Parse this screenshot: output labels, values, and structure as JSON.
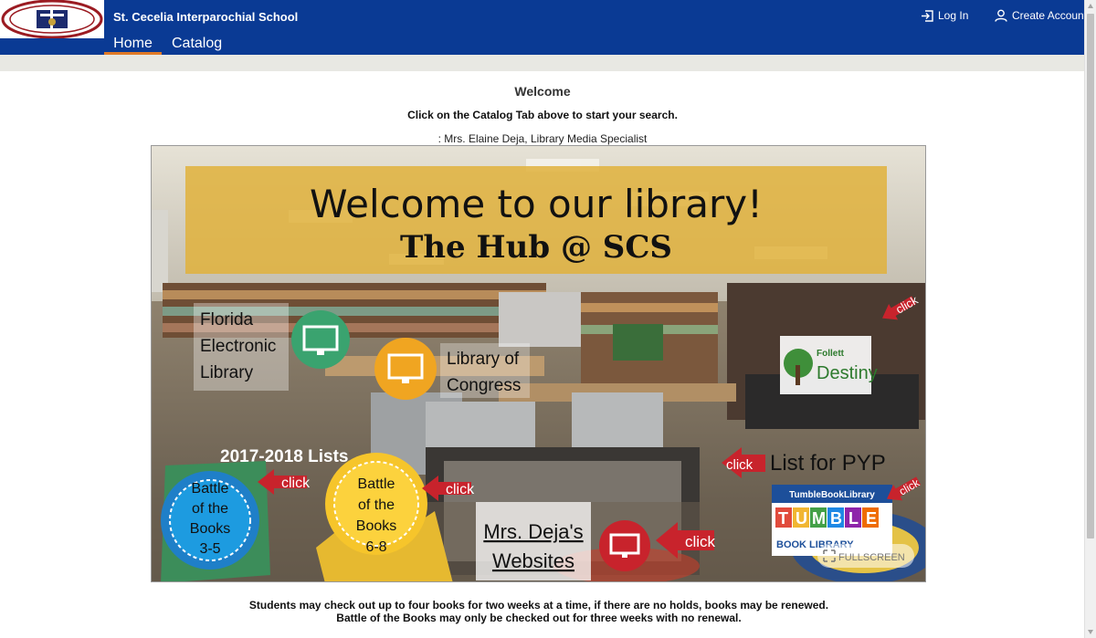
{
  "header": {
    "school_name": "St. Cecelia Interparochial School",
    "tabs": [
      {
        "label": "Home",
        "active": true
      },
      {
        "label": "Catalog",
        "active": false
      }
    ],
    "login_label": "Log In",
    "create_account_label": "Create Account",
    "brand_color": "#0a3a94",
    "active_tab_color": "#e07a27"
  },
  "main": {
    "welcome_title": "Welcome",
    "instruction": "Click on the Catalog Tab above to start your search.",
    "librarian": ": Mrs. Elaine Deja, Library Media Specialist"
  },
  "banner": {
    "headline": "Welcome to our library!",
    "subheadline": "The Hub @ SCS",
    "florida_lines": [
      "Florida",
      "Electronic",
      "Library"
    ],
    "congress_lines": [
      "Library of",
      "Congress"
    ],
    "lists_title": "2017-2018 Lists",
    "badge_35_lines": [
      "Battle",
      "of the",
      "Books",
      "3-5"
    ],
    "badge_68_lines": [
      "Battle",
      "of the",
      "Books",
      "6-8"
    ],
    "click_label": "click",
    "pyp_label": "List for PYP",
    "websites_lines": [
      "Mrs. Deja's",
      "Websites"
    ],
    "destiny_lines": [
      "Follett",
      "Destiny"
    ],
    "tumble_header": "TumbleBookLibrary",
    "tumble_letters": [
      "T",
      "U",
      "M",
      "B",
      "L",
      "E"
    ],
    "tumble_sub": "BOOK LIBRARY",
    "fullscreen_label": "FULLSCREEN"
  },
  "footer": {
    "line1": "Students may check out up to four books for two weeks at a time, if there are no holds, books may be renewed.",
    "line2": "Battle of the Books may only be checked out for three weeks with no renewal."
  }
}
